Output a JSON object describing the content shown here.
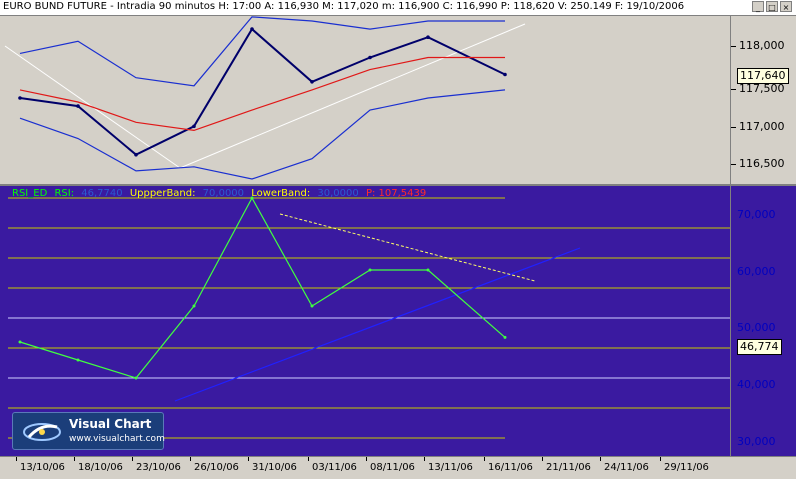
{
  "window": {
    "title": "EURO BUND FUTURE - Intradia 90 minutos H: 17:00  A: 116,930  M: 117,020  m: 116,900  C: 116,990  P: 118,620  V: 250.149  F: 19/10/2006",
    "buttons": [
      "_",
      "□",
      "×"
    ]
  },
  "price_axis": {
    "ticks": [
      "118,000",
      "117,500",
      "117,000",
      "116,500"
    ],
    "current_value": "117,640"
  },
  "rsi_axis": {
    "ticks": [
      "70,000",
      "60,000",
      "50,000",
      "40,000",
      "30,000"
    ],
    "current_value": "46,774"
  },
  "rsi_legend": {
    "name": "RSI_ED",
    "rsi_label": "RSI:",
    "rsi_value": "46,7740",
    "upper_label": "UppperBand:",
    "upper_value": "70,0000",
    "lower_label": "LowerBand:",
    "lower_value": "30,0000",
    "p_label": "P: 107,5439",
    "colors": {
      "name": "#00ff00",
      "upper": "#ffff00",
      "lower": "#ffff00",
      "p": "#ff0000"
    }
  },
  "x_axis": {
    "labels": [
      "13/10/06",
      "18/10/06",
      "23/10/06",
      "26/10/06",
      "31/10/06",
      "03/11/06",
      "08/11/06",
      "13/11/06",
      "16/11/06",
      "21/11/06",
      "24/11/06",
      "29/11/06"
    ]
  },
  "logo": {
    "title": "Visual Chart",
    "url": "www.visualchart.com"
  },
  "chart_data": [
    {
      "type": "line",
      "title": "EURO BUND FUTURE - Intradia 90 minutos",
      "x": [
        "13/10/06",
        "18/10/06",
        "23/10/06",
        "26/10/06",
        "31/10/06",
        "03/11/06",
        "08/11/06",
        "13/11/06",
        "16/11/06"
      ],
      "series": [
        {
          "name": "Close",
          "values": [
            117.35,
            117.25,
            116.65,
            117.0,
            118.2,
            117.55,
            117.85,
            118.1,
            117.64
          ]
        },
        {
          "name": "Moving average",
          "values": [
            117.45,
            117.3,
            117.05,
            116.95,
            117.2,
            117.45,
            117.7,
            117.85,
            117.85
          ]
        },
        {
          "name": "Upper band",
          "values": [
            117.9,
            118.05,
            117.6,
            117.5,
            118.35,
            118.3,
            118.2,
            118.3,
            118.3
          ]
        },
        {
          "name": "Lower band",
          "values": [
            117.1,
            116.85,
            116.45,
            116.5,
            116.35,
            116.6,
            117.2,
            117.35,
            117.45
          ]
        }
      ],
      "ylim": [
        116.35,
        118.3
      ],
      "yticks": [
        "118,000",
        "117,500",
        "117,000",
        "116,500"
      ]
    },
    {
      "type": "line",
      "title": "RSI_ED",
      "x": [
        "13/10/06",
        "18/10/06",
        "23/10/06",
        "26/10/06",
        "31/10/06",
        "03/11/06",
        "08/11/06",
        "13/11/06",
        "16/11/06"
      ],
      "series": [
        {
          "name": "RSI",
          "values": [
            46,
            43,
            40,
            52,
            70,
            52,
            58,
            58,
            46.774
          ]
        }
      ],
      "bands": [
        70,
        65,
        60,
        55,
        50,
        45,
        40,
        35,
        30
      ],
      "ylim": [
        27,
        72
      ],
      "yticks": [
        "70,000",
        "60,000",
        "50,000",
        "40,000",
        "30,000"
      ]
    }
  ]
}
